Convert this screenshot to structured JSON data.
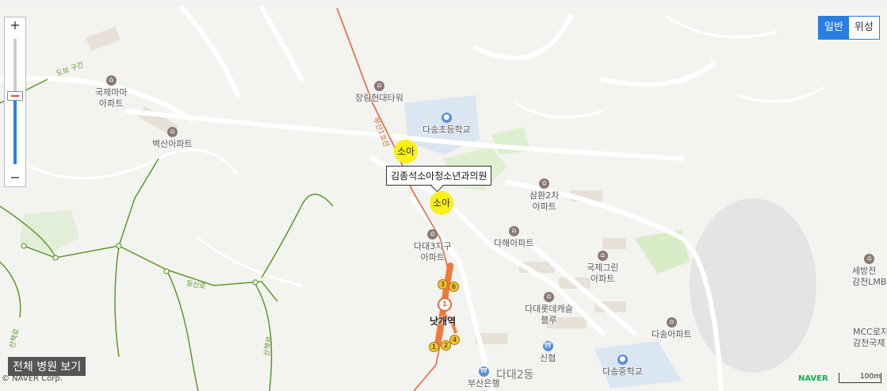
{
  "map": {
    "pois": [
      {
        "name": "국제마마\n아파트",
        "type": "apartment"
      },
      {
        "name": "벽산아파트",
        "type": "apartment"
      },
      {
        "name": "장림현대타워",
        "type": "apartment"
      },
      {
        "name": "다송초등학교",
        "type": "school"
      },
      {
        "name": "삼환2차\n아파트",
        "type": "apartment"
      },
      {
        "name": "다대3지구\n아파트",
        "type": "apartment"
      },
      {
        "name": "다해아파트",
        "type": "apartment"
      },
      {
        "name": "국제그린\n아파트",
        "type": "apartment"
      },
      {
        "name": "다대롯데캐슬\n블루",
        "type": "apartment"
      },
      {
        "name": "다송아파트",
        "type": "apartment"
      },
      {
        "name": "신협",
        "type": "bank"
      },
      {
        "name": "다송중학교",
        "type": "school"
      },
      {
        "name": "부산은행",
        "type": "bank"
      },
      {
        "name": "세방전\n감천LMB",
        "type": "place"
      },
      {
        "name": "MCC로지\n감천국제",
        "type": "place"
      }
    ],
    "station": "낫개역",
    "district": "다대2동",
    "road_label": "부산1호선",
    "metro_number": "1",
    "exits": [
      "1",
      "2",
      "3",
      "4",
      "6"
    ],
    "markers": [
      "소아",
      "소아"
    ],
    "tooltip": "김종석소아청소년과의원",
    "trail_labels": [
      "도보 구간",
      "등산로",
      "산책로",
      "산책로"
    ]
  },
  "controls": {
    "zoom_in": "+",
    "zoom_out": "−",
    "zoom_level": 0.55,
    "map_type_normal": "일반",
    "map_type_satellite": "위성",
    "show_all_button": "전체 병원 보기",
    "credit": "© NAVER Corp.",
    "naver_logo": "NAVER",
    "scale": "100m"
  },
  "colors": {
    "metro_line": "#e8683a",
    "marker": "#f8f018",
    "accent": "#2a7de1",
    "trail": "#5a9a2a"
  }
}
